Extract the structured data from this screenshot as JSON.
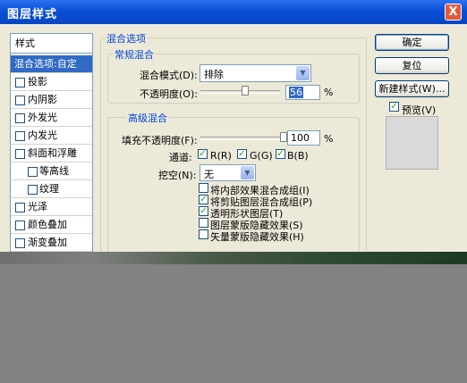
{
  "window": {
    "title": "图层样式",
    "close_label": "X"
  },
  "style_list": {
    "header": "样式",
    "items": [
      {
        "label": "混合选项:自定",
        "has_checkbox": false,
        "selected": true,
        "indent": false
      },
      {
        "label": "投影",
        "has_checkbox": true,
        "indent": false
      },
      {
        "label": "内阴影",
        "has_checkbox": true,
        "indent": false
      },
      {
        "label": "外发光",
        "has_checkbox": true,
        "indent": false
      },
      {
        "label": "内发光",
        "has_checkbox": true,
        "indent": false
      },
      {
        "label": "斜面和浮雕",
        "has_checkbox": true,
        "indent": false
      },
      {
        "label": "等高线",
        "has_checkbox": true,
        "indent": true
      },
      {
        "label": "纹理",
        "has_checkbox": true,
        "indent": true
      },
      {
        "label": "光泽",
        "has_checkbox": true,
        "indent": false
      },
      {
        "label": "颜色叠加",
        "has_checkbox": true,
        "indent": false
      },
      {
        "label": "渐变叠加",
        "has_checkbox": true,
        "indent": false
      }
    ]
  },
  "blend_options": {
    "title": "混合选项",
    "general": {
      "title": "常规混合",
      "mode_label": "混合模式(D):",
      "mode_value": "排除",
      "opacity_label": "不透明度(O):",
      "opacity_value": "56",
      "opacity_unit": "%",
      "opacity_level": 0.56
    },
    "advanced": {
      "title": "高级混合",
      "fill_label": "填充不透明度(F):",
      "fill_value": "100",
      "fill_unit": "%",
      "fill_level": 1.0,
      "channels_label": "通道:",
      "channel_r": "R(R)",
      "channel_g": "G(G)",
      "channel_b": "B(B)",
      "knockout_label": "挖空(N):",
      "knockout_value": "无",
      "options": [
        {
          "label": "将内部效果混合成组(I)",
          "checked": false
        },
        {
          "label": "将剪贴图层混合成组(P)",
          "checked": true
        },
        {
          "label": "透明形状图层(T)",
          "checked": true
        },
        {
          "label": "图层蒙版隐藏效果(S)",
          "checked": false
        },
        {
          "label": "矢量蒙版隐藏效果(H)",
          "checked": false
        }
      ]
    }
  },
  "buttons": {
    "ok": "确定",
    "reset": "复位",
    "new_style": "新建样式(W)...",
    "preview": "预览(V)"
  },
  "colors": {
    "titlebar": "#0a4fd8",
    "selected": "#316ac5",
    "group_label": "#0046d5",
    "check": "#21a121"
  }
}
